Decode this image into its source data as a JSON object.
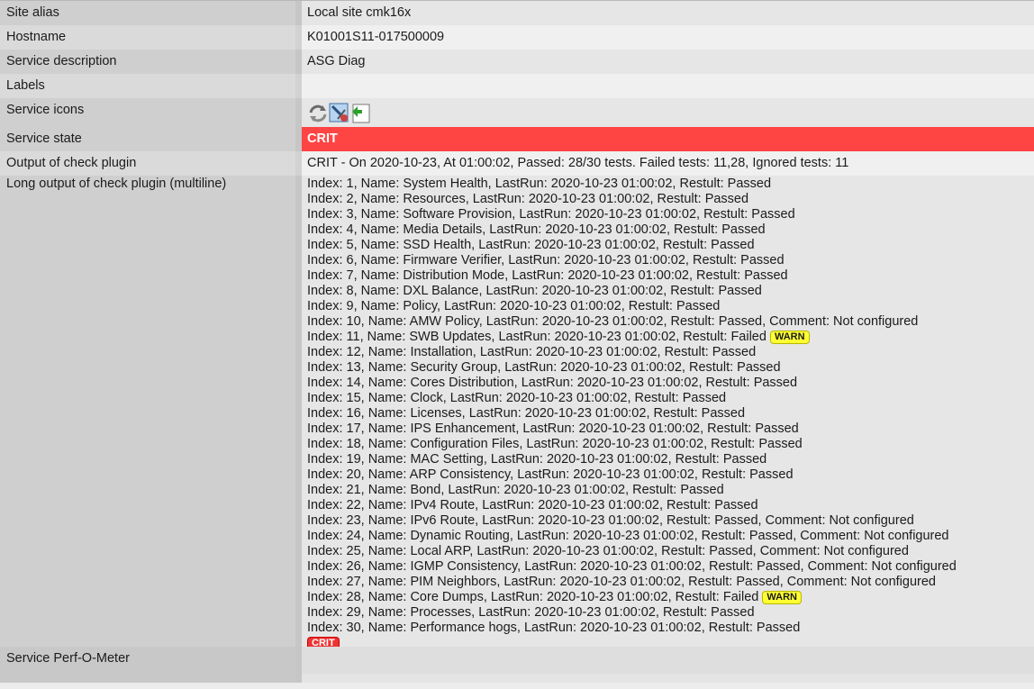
{
  "colors": {
    "crit": "#ff4444",
    "warn_badge": "#ffff33",
    "crit_badge": "#ee3333"
  },
  "rows": {
    "site_alias": {
      "label": "Site alias",
      "value": "Local site cmk16x"
    },
    "hostname": {
      "label": "Hostname",
      "value": "K01001S11-017500009"
    },
    "service_description": {
      "label": "Service description",
      "value": "ASG Diag"
    },
    "labels": {
      "label": "Labels",
      "value": ""
    },
    "service_icons": {
      "label": "Service icons",
      "icons": [
        "reload-icon",
        "wato-rule-icon",
        "download-agent-icon"
      ]
    },
    "service_state": {
      "label": "Service state",
      "value": "CRIT"
    },
    "output": {
      "label": "Output of check plugin",
      "value": "CRIT - On 2020-10-23, At 01:00:02, Passed: 28/30 tests. Failed tests: 11,28, Ignored tests: 11"
    },
    "long_output": {
      "label": "Long output of check plugin (multiline)",
      "lines": [
        {
          "text": "Index: 1, Name: System Health, LastRun: 2020-10-23 01:00:02, Restult: Passed",
          "badge": ""
        },
        {
          "text": "Index: 2, Name: Resources, LastRun: 2020-10-23 01:00:02, Restult: Passed",
          "badge": ""
        },
        {
          "text": "Index: 3, Name: Software Provision, LastRun: 2020-10-23 01:00:02, Restult: Passed",
          "badge": ""
        },
        {
          "text": "Index: 4, Name: Media Details, LastRun: 2020-10-23 01:00:02, Restult: Passed",
          "badge": ""
        },
        {
          "text": "Index: 5, Name: SSD Health, LastRun: 2020-10-23 01:00:02, Restult: Passed",
          "badge": ""
        },
        {
          "text": "Index: 6, Name: Firmware Verifier, LastRun: 2020-10-23 01:00:02, Restult: Passed",
          "badge": ""
        },
        {
          "text": "Index: 7, Name: Distribution Mode, LastRun: 2020-10-23 01:00:02, Restult: Passed",
          "badge": ""
        },
        {
          "text": "Index: 8, Name: DXL Balance, LastRun: 2020-10-23 01:00:02, Restult: Passed",
          "badge": ""
        },
        {
          "text": "Index: 9, Name: Policy, LastRun: 2020-10-23 01:00:02, Restult: Passed",
          "badge": ""
        },
        {
          "text": "Index: 10, Name: AMW Policy, LastRun: 2020-10-23 01:00:02, Restult: Passed, Comment: Not configured",
          "badge": ""
        },
        {
          "text": "Index: 11, Name: SWB Updates, LastRun: 2020-10-23 01:00:02, Restult: Failed",
          "badge": "WARN"
        },
        {
          "text": "Index: 12, Name: Installation, LastRun: 2020-10-23 01:00:02, Restult: Passed",
          "badge": ""
        },
        {
          "text": "Index: 13, Name: Security Group, LastRun: 2020-10-23 01:00:02, Restult: Passed",
          "badge": ""
        },
        {
          "text": "Index: 14, Name: Cores Distribution, LastRun: 2020-10-23 01:00:02, Restult: Passed",
          "badge": ""
        },
        {
          "text": "Index: 15, Name: Clock, LastRun: 2020-10-23 01:00:02, Restult: Passed",
          "badge": ""
        },
        {
          "text": "Index: 16, Name: Licenses, LastRun: 2020-10-23 01:00:02, Restult: Passed",
          "badge": ""
        },
        {
          "text": "Index: 17, Name: IPS Enhancement, LastRun: 2020-10-23 01:00:02, Restult: Passed",
          "badge": ""
        },
        {
          "text": "Index: 18, Name: Configuration Files, LastRun: 2020-10-23 01:00:02, Restult: Passed",
          "badge": ""
        },
        {
          "text": "Index: 19, Name: MAC Setting, LastRun: 2020-10-23 01:00:02, Restult: Passed",
          "badge": ""
        },
        {
          "text": "Index: 20, Name: ARP Consistency, LastRun: 2020-10-23 01:00:02, Restult: Passed",
          "badge": ""
        },
        {
          "text": "Index: 21, Name: Bond, LastRun: 2020-10-23 01:00:02, Restult: Passed",
          "badge": ""
        },
        {
          "text": "Index: 22, Name: IPv4 Route, LastRun: 2020-10-23 01:00:02, Restult: Passed",
          "badge": ""
        },
        {
          "text": "Index: 23, Name: IPv6 Route, LastRun: 2020-10-23 01:00:02, Restult: Passed, Comment: Not configured",
          "badge": ""
        },
        {
          "text": "Index: 24, Name: Dynamic Routing, LastRun: 2020-10-23 01:00:02, Restult: Passed, Comment: Not configured",
          "badge": ""
        },
        {
          "text": "Index: 25, Name: Local ARP, LastRun: 2020-10-23 01:00:02, Restult: Passed, Comment: Not configured",
          "badge": ""
        },
        {
          "text": "Index: 26, Name: IGMP Consistency, LastRun: 2020-10-23 01:00:02, Restult: Passed, Comment: Not configured",
          "badge": ""
        },
        {
          "text": "Index: 27, Name: PIM Neighbors, LastRun: 2020-10-23 01:00:02, Restult: Passed, Comment: Not configured",
          "badge": ""
        },
        {
          "text": "Index: 28, Name: Core Dumps, LastRun: 2020-10-23 01:00:02, Restult: Failed",
          "badge": "WARN"
        },
        {
          "text": "Index: 29, Name: Processes, LastRun: 2020-10-23 01:00:02, Restult: Passed",
          "badge": ""
        },
        {
          "text": "Index: 30, Name: Performance hogs, LastRun: 2020-10-23 01:00:02, Restult: Passed",
          "badge": ""
        }
      ],
      "final_badge": "CRIT"
    },
    "perf_o_meter": {
      "label": "Service Perf-O-Meter",
      "value": ""
    }
  }
}
